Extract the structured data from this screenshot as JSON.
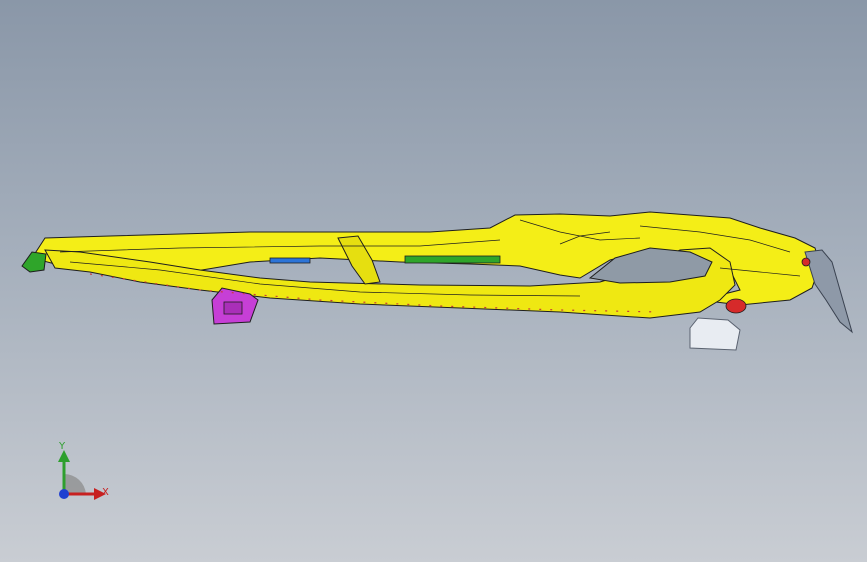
{
  "viewport": {
    "background_top": "#8a97a8",
    "background_bottom": "#c9cdd3"
  },
  "model": {
    "main_color": "#f4ee17",
    "outline_color": "#1e1e1e",
    "bracket_color": "#c63fd6",
    "accent_colors": {
      "green": "#2fa52a",
      "blue": "#2c74d8",
      "red": "#d62a2a",
      "white": "#e8ecf2",
      "gray": "#8e99a8"
    }
  },
  "triad": {
    "y_label": "Y",
    "x_label": "X",
    "y_color": "#2e9f2e",
    "x_color": "#c72020",
    "z_color": "#1f3fd0"
  }
}
